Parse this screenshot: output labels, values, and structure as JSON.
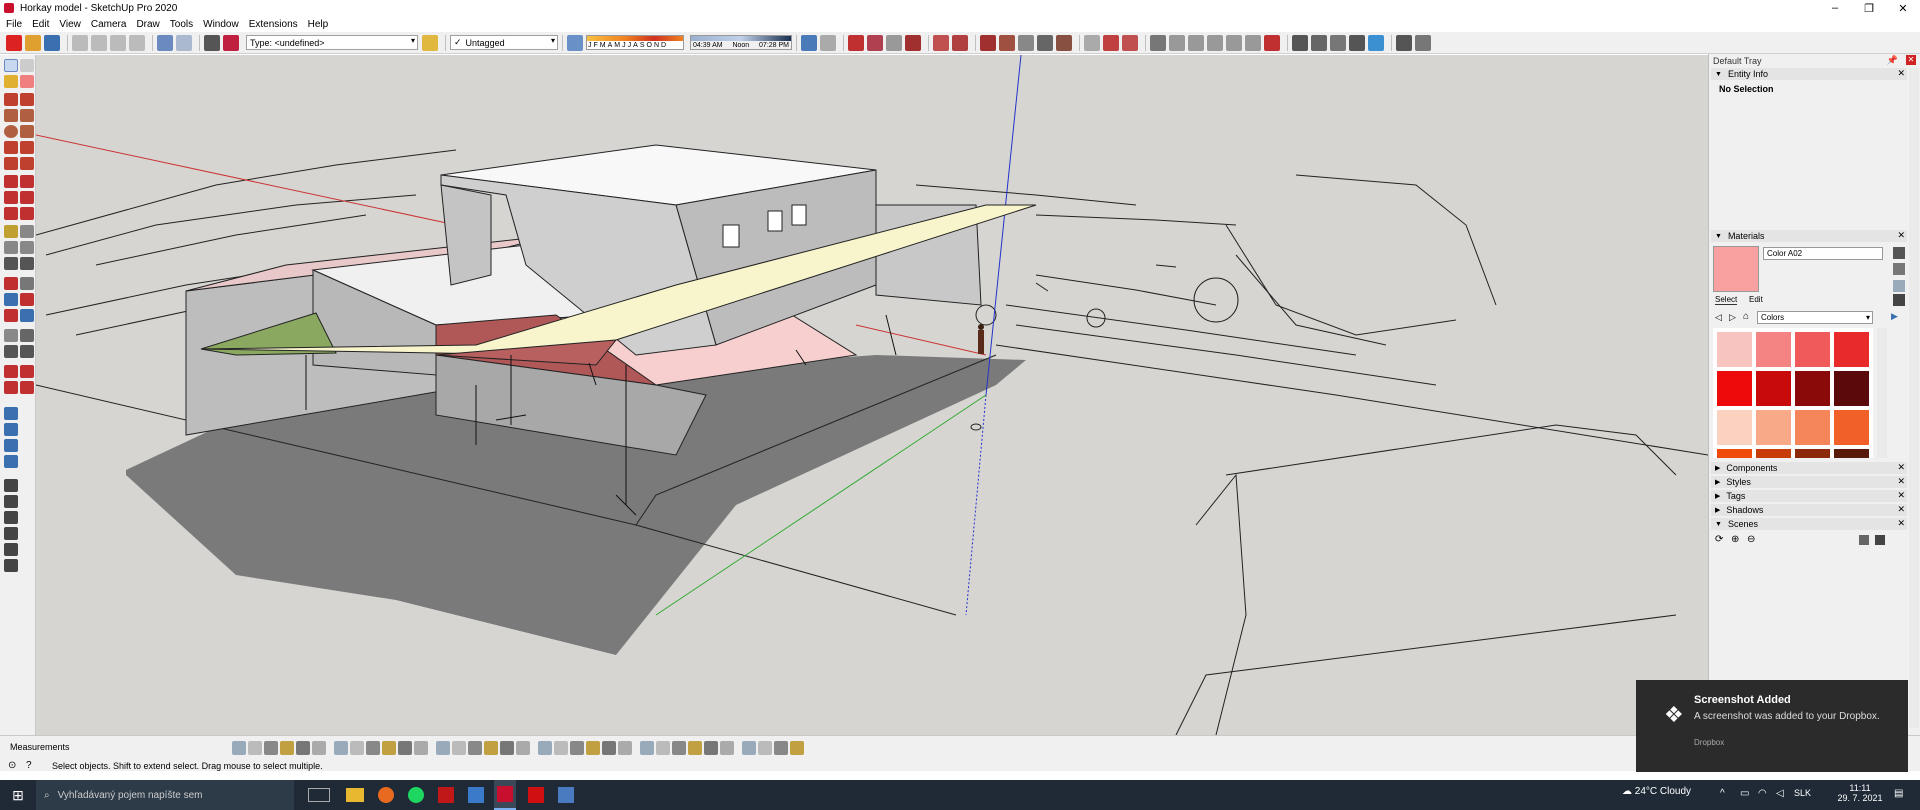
{
  "window": {
    "title": "Horkay model - SketchUp Pro 2020",
    "controls": [
      "–",
      "❐",
      "✕"
    ]
  },
  "menu": [
    "File",
    "Edit",
    "View",
    "Camera",
    "Draw",
    "Tools",
    "Window",
    "Extensions",
    "Help"
  ],
  "toolbar": {
    "type_combo": "Type: <undefined>",
    "tag_combo": "Untagged",
    "months": [
      "J",
      "F",
      "M",
      "A",
      "M",
      "J",
      "J",
      "A",
      "S",
      "O",
      "N",
      "D"
    ],
    "time_start": "04:39 AM",
    "time_noon": "Noon",
    "time_end": "07:28 PM"
  },
  "tray": {
    "title": "Default Tray",
    "entity_info": {
      "header": "Entity Info",
      "value": "No Selection"
    },
    "materials": {
      "header": "Materials",
      "current_name": "Color A02",
      "current_color": "#f9a0a0",
      "tab_select": "Select",
      "tab_edit": "Edit",
      "library": "Colors",
      "swatches": [
        "#f8c4c0",
        "#f48484",
        "#f05a5a",
        "#e82a2a",
        "#ee0a0a",
        "#c80a0a",
        "#8a0a0a",
        "#5a0a0a",
        "#fbd2c0",
        "#f8aa88",
        "#f4865a",
        "#f06028",
        "#f04a0a",
        "#c83c0a",
        "#8a2a0a",
        "#5a1a0a"
      ]
    },
    "panels": [
      "Components",
      "Styles",
      "Tags",
      "Shadows",
      "Scenes"
    ]
  },
  "status": {
    "measurements_label": "Measurements",
    "hint": "Select objects. Shift to extend select. Drag mouse to select multiple."
  },
  "toast": {
    "title": "Screenshot Added",
    "body": "A screenshot was added to your Dropbox.",
    "source": "Dropbox"
  },
  "taskbar": {
    "search_placeholder": "Vyhľadávaný pojem napíšte sem",
    "weather": "24°C Cloudy",
    "language": "SLK",
    "time": "11:11",
    "date": "29. 7. 2021"
  },
  "colors": {
    "accent_red": "#c8102e",
    "tray_bg": "#f0f0f0",
    "viewport_bg": "#d6d5d1"
  }
}
